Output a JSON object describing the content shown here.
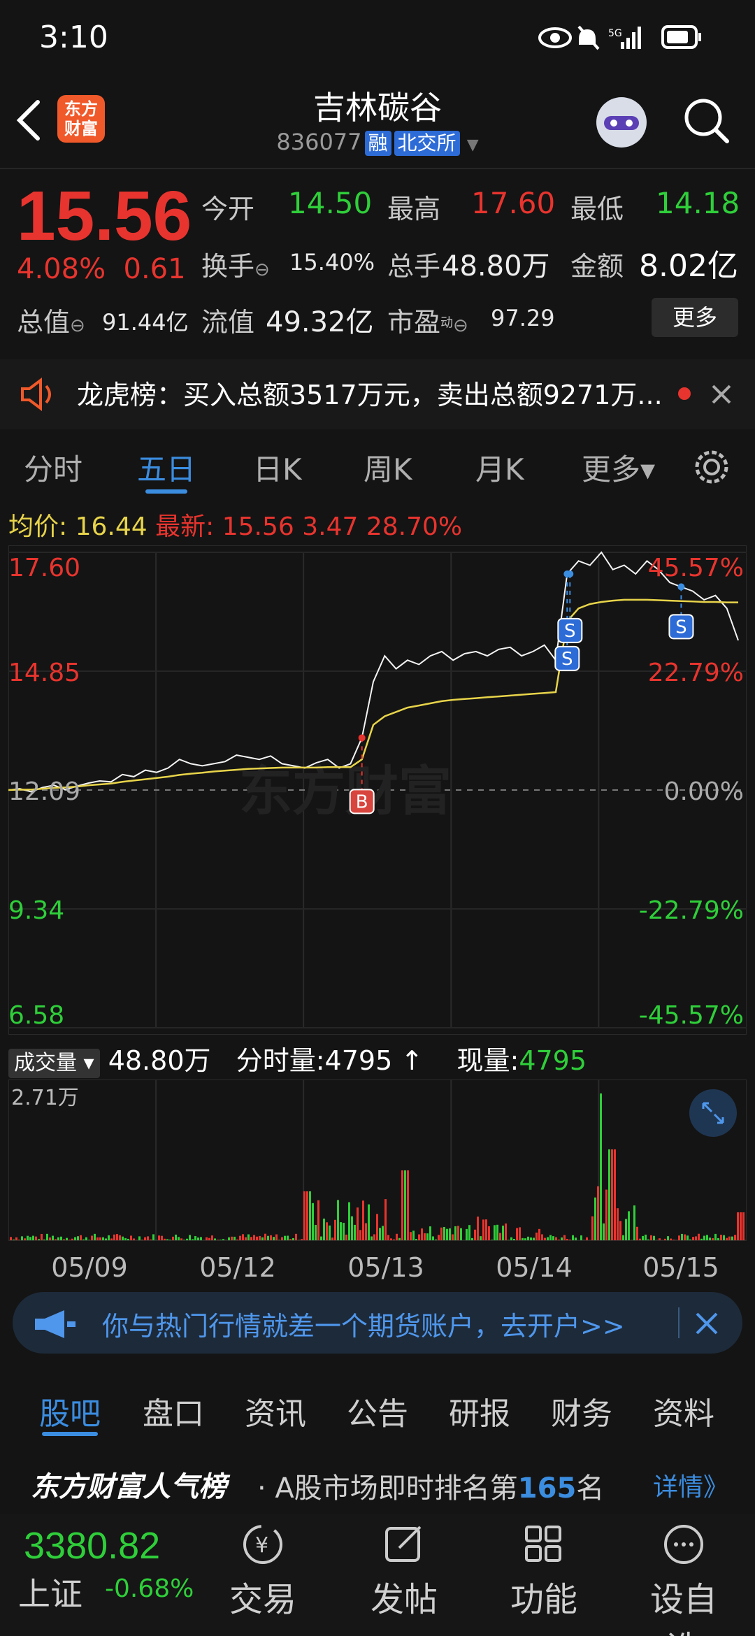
{
  "status": {
    "time": "3:10",
    "network": "5G"
  },
  "header": {
    "logo_text_line1": "东方",
    "logo_text_line2": "财富",
    "title": "吉林碳谷",
    "code": "836077",
    "tag1": "融",
    "tag2": "北交所"
  },
  "quote": {
    "price": "15.56",
    "pct": "4.08%",
    "change": "0.61",
    "open_label": "今开",
    "open": "14.50",
    "high_label": "最高",
    "high": "17.60",
    "low_label": "最低",
    "low": "14.18",
    "turnover_label": "换手",
    "turnover": "15.40%",
    "volume_label": "总手",
    "volume": "48.80万",
    "amount_label": "金额",
    "amount": "8.02亿",
    "mktcap_label": "总值",
    "mktcap": "91.44亿",
    "float_label": "流值",
    "float": "49.32亿",
    "pe_label": "市盈",
    "pe_sup": "动",
    "pe": "97.29",
    "more": "更多"
  },
  "notice": {
    "text": "龙虎榜：买入总额3517万元，卖出总额9271万..."
  },
  "tabs": [
    {
      "label": "分时"
    },
    {
      "label": "五日"
    },
    {
      "label": "日K"
    },
    {
      "label": "周K"
    },
    {
      "label": "月K"
    },
    {
      "label": "更多▾"
    }
  ],
  "chart_head": {
    "avg_label": "均价:",
    "avg": "16.44",
    "latest_label": "最新:",
    "latest": "15.56",
    "chg": "3.47",
    "pct": "28.70%"
  },
  "chart_data": {
    "type": "line",
    "y_labels_left": [
      "17.60",
      "14.85",
      "12.09",
      "9.34",
      "6.58"
    ],
    "y_labels_right": [
      "45.57%",
      "22.79%",
      "0.00%",
      "-22.79%",
      "-45.57%"
    ],
    "ylim": [
      6.58,
      17.6
    ],
    "base": 12.09,
    "days": [
      "05/09",
      "05/12",
      "05/13",
      "05/14",
      "05/15"
    ],
    "series": [
      {
        "values": [
          12.09,
          12.12,
          12.05,
          12.15,
          12.2,
          12.1,
          12.18,
          12.25,
          12.3,
          12.28,
          12.45,
          12.4,
          12.55,
          12.5,
          12.6,
          12.8,
          12.7,
          12.65,
          12.7,
          12.75,
          12.9,
          12.85,
          12.8,
          12.88,
          12.7,
          12.65,
          12.6,
          12.72,
          12.8,
          12.6,
          12.7,
          13.3,
          14.6,
          15.2,
          14.9,
          15.1,
          15.0,
          15.2,
          15.3,
          15.1,
          15.25,
          15.3,
          15.2,
          15.35,
          15.4,
          15.2,
          15.3,
          15.45,
          15.1,
          17.1,
          17.4,
          17.3,
          17.6,
          17.2,
          17.3,
          17.1,
          17.4,
          17.2,
          16.9,
          16.8,
          16.7,
          16.5,
          16.6,
          16.3,
          15.56
        ]
      },
      {
        "values": [
          12.09,
          12.1,
          12.1,
          12.12,
          12.14,
          12.15,
          12.17,
          12.2,
          12.22,
          12.24,
          12.28,
          12.31,
          12.34,
          12.37,
          12.4,
          12.44,
          12.47,
          12.49,
          12.52,
          12.54,
          12.56,
          12.58,
          12.59,
          12.6,
          12.61,
          12.61,
          12.61,
          12.61,
          12.62,
          12.62,
          12.62,
          12.8,
          13.6,
          13.8,
          13.9,
          14.0,
          14.05,
          14.1,
          14.15,
          14.18,
          14.2,
          14.22,
          14.24,
          14.26,
          14.28,
          14.3,
          14.32,
          14.34,
          14.36,
          16.0,
          16.3,
          16.4,
          16.45,
          16.48,
          16.5,
          16.5,
          16.5,
          16.49,
          16.48,
          16.47,
          16.46,
          16.45,
          16.45,
          16.44,
          16.44
        ]
      }
    ],
    "signals": [
      "B",
      "S",
      "S",
      "S"
    ],
    "watermark": "东方财富"
  },
  "volume": {
    "label": "成交量",
    "total": "48.80万",
    "min_label": "分时量:4795",
    "now_label": "现量:",
    "now": "4795",
    "ymax": "2.71万"
  },
  "banner": {
    "text": "你与热门行情就差一个期货账户，去开户>>"
  },
  "bottom_tabs": [
    {
      "label": "股吧"
    },
    {
      "label": "盘口"
    },
    {
      "label": "资讯"
    },
    {
      "label": "公告"
    },
    {
      "label": "研报"
    },
    {
      "label": "财务"
    },
    {
      "label": "资料"
    }
  ],
  "rank": {
    "brand": "东方财富人气榜",
    "text": "· A股市场即时排名第",
    "num": "165",
    "suffix": "名",
    "more": "详情》"
  },
  "nav": {
    "index_value": "3380.82",
    "index_name": "上证",
    "index_change": "-0.68%",
    "items": [
      {
        "label": "交易"
      },
      {
        "label": "发帖"
      },
      {
        "label": "功能"
      },
      {
        "label": "设自选"
      }
    ]
  },
  "colors": {
    "up": "#e8342e",
    "down": "#2fcf3a",
    "accent": "#3b8de0",
    "avg_line": "#e8d44a"
  }
}
